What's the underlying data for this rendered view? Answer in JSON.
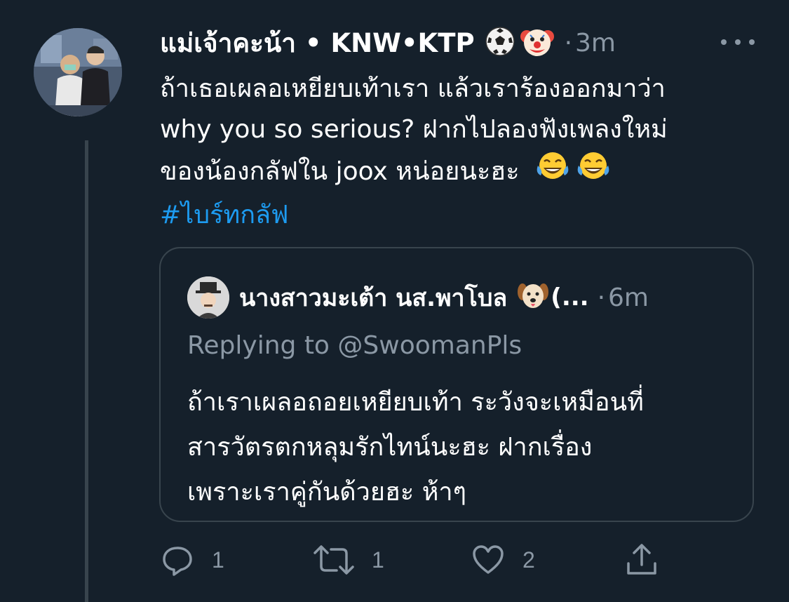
{
  "tweet": {
    "author_name": "แม่เจ้าคะน้า • KNW•KTP",
    "dot": "·",
    "time": "3m",
    "body_lines": [
      "ถ้าเธอเผลอเหยียบเท้าเรา แล้วเราร้องออกมาว่า",
      "why you so serious? ฝากไปลองฟังเพลงใหม่",
      "ของน้องกลัฟใน joox หน่อยนะฮะ"
    ],
    "hashtag": "#ไบร์ทกลัฟ",
    "header_emojis": [
      "soccer-ball",
      "clown-face"
    ],
    "body_emojis": [
      "face-with-tears-of-joy",
      "face-with-tears-of-joy"
    ]
  },
  "quote": {
    "author_name": "นางสาวมะเต้า นส.พาโบล",
    "author_suffix": "(...",
    "dot": "·",
    "time": "6m",
    "replying_to": "Replying to @SwoomanPls",
    "body_lines": [
      "ถ้าเราเผลอถอยเหยียบเท้า ระวังจะเหมือนที่",
      "สารวัตรตกหลุมรักไทน์นะฮะ ฝากเรื่อง",
      "เพราะเราคู่กันด้วยฮะ ห้าๆ"
    ],
    "name_emoji": "dog-face"
  },
  "actions": {
    "reply_count": "1",
    "retweet_count": "1",
    "like_count": "2"
  },
  "colors": {
    "background": "#15202b",
    "secondary_text": "#8b98a5",
    "link": "#1d9bf0",
    "border": "#38444d"
  }
}
